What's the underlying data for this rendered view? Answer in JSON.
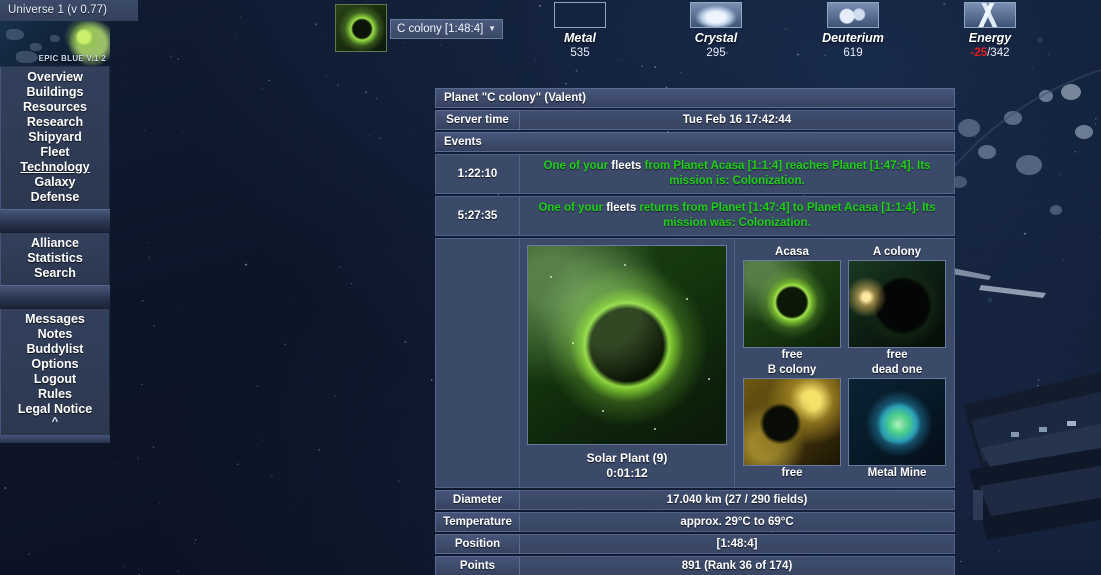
{
  "universe": {
    "label": "Universe 1 (v 0.77)"
  },
  "sidebar": {
    "banner_text": "EPIC BLUE V.1 2",
    "groups": [
      {
        "items": [
          {
            "label": "Overview",
            "active": false
          },
          {
            "label": "Buildings",
            "active": false
          },
          {
            "label": "Resources",
            "active": false
          },
          {
            "label": "Research",
            "active": false
          },
          {
            "label": "Shipyard",
            "active": false
          },
          {
            "label": "Fleet",
            "active": false
          },
          {
            "label": "Technology",
            "active": true
          },
          {
            "label": "Galaxy",
            "active": false
          },
          {
            "label": "Defense",
            "active": false
          }
        ]
      },
      {
        "items": [
          {
            "label": "Alliance",
            "active": false
          },
          {
            "label": "Statistics",
            "active": false
          },
          {
            "label": "Search",
            "active": false
          }
        ]
      },
      {
        "items": [
          {
            "label": "Messages",
            "active": false
          },
          {
            "label": "Notes",
            "active": false
          },
          {
            "label": "Buddylist",
            "active": false
          },
          {
            "label": "Options",
            "active": false
          },
          {
            "label": "Logout",
            "active": false
          },
          {
            "label": "Rules",
            "active": false
          },
          {
            "label": "Legal Notice",
            "active": false
          }
        ]
      }
    ],
    "collapse_caret": "^"
  },
  "topbar": {
    "planet_selector": {
      "value": "C colony [1:48:4]",
      "caret": "▼"
    },
    "resources": [
      {
        "name": "Metal",
        "value": "535",
        "icon": "metal-icon"
      },
      {
        "name": "Crystal",
        "value": "295",
        "icon": "crystal-icon"
      },
      {
        "name": "Deuterium",
        "value": "619",
        "icon": "deuterium-icon"
      },
      {
        "name": "Energy",
        "value": "-25",
        "value_max": "/342",
        "icon": "energy-icon"
      }
    ]
  },
  "panel": {
    "title": "Planet \"C colony\" (Valent)",
    "server_time_label": "Server time",
    "server_time_value": "Tue Feb 16 17:42:44",
    "events_label": "Events",
    "events": [
      {
        "time": "1:22:10",
        "pre": "One of your ",
        "link": "fleets",
        "post": " from Planet Acasa [1:1:4] reaches Planet [1:47:4]. Its mission is: Colonization."
      },
      {
        "time": "5:27:35",
        "pre": "One of your ",
        "link": "fleets",
        "post": " returns from Planet [1:47:4] to Planet Acasa [1:1:4]. Its mission was: Colonization."
      }
    ],
    "main_planet": {
      "build_name": "Solar Plant (9)",
      "build_timer": "0:01:12",
      "image": "planet-c-colony-image"
    },
    "planet_grid": [
      {
        "name": "Acasa",
        "status": "free",
        "image": "planet-acasa-thumb"
      },
      {
        "name": "A colony",
        "status": "free",
        "image": "planet-a-colony-thumb"
      },
      {
        "name": "B colony",
        "status": "free",
        "image": "planet-b-colony-thumb"
      },
      {
        "name": "dead one",
        "status": "Metal Mine",
        "image": "planet-dead-one-thumb"
      }
    ],
    "stats": [
      {
        "label": "Diameter",
        "value": "17.040 km (27 / 290 fields)"
      },
      {
        "label": "Temperature",
        "value": "approx. 29°C to 69°C"
      },
      {
        "label": "Position",
        "value": "[1:48:4]"
      },
      {
        "label": "Points",
        "value": "891 (Rank 36 of 174)"
      }
    ]
  },
  "colors": {
    "event_green": "#1fd014",
    "energy_negative": "#e81b1b",
    "panel_bg": "#3b4a69",
    "bar_bg": "#46557a"
  }
}
